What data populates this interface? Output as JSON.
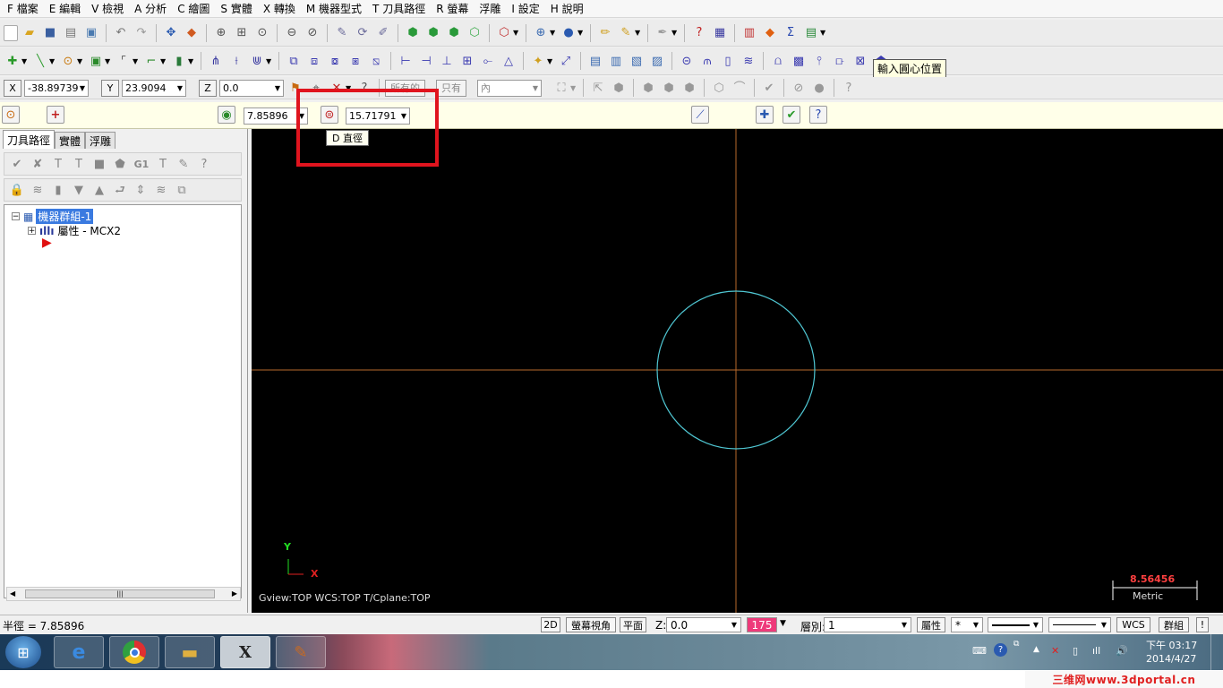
{
  "menu": [
    "F 檔案",
    "E 編輯",
    "V 檢視",
    "A 分析",
    "C 繪圖",
    "S 實體",
    "X 轉換",
    "M 機器型式",
    "T 刀具路徑",
    "R 螢幕",
    "浮雕",
    "I 設定",
    "H 說明"
  ],
  "tooltip_center": "輸入圓心位置",
  "coords": {
    "x_label": "X",
    "x_value": "-38.89739",
    "y_label": "Y",
    "y_value": "23.9094",
    "z_label": "Z",
    "z_value": "0.0"
  },
  "select": {
    "all_label": "所有的",
    "only_label": "只有",
    "mode_value": "內"
  },
  "ribbon": {
    "radius_value": "7.85896",
    "diameter_value": "15.71791",
    "diameter_tip": "D 直徑"
  },
  "panel": {
    "tabs": [
      "刀具路徑",
      "實體",
      "浮雕"
    ],
    "tree_group": "機器群組-1",
    "tree_props": "屬性 - MCX2",
    "gcode_icon_text": "G1"
  },
  "viewport": {
    "axis_y": "Y",
    "axis_x": "X",
    "view_info": "Gview:TOP   WCS:TOP   T/Cplane:TOP",
    "scale_value": "8.56456",
    "scale_unit": "Metric",
    "colors": {
      "background": "#000000",
      "crosshair": "#b86a2c",
      "circle": "#4fc6d2",
      "scale_value": "#ff4040"
    }
  },
  "status": {
    "left_text": "半徑 = 7.85896",
    "btn_2d": "2D",
    "btn_screen_view": "螢幕視角",
    "btn_plane": "平面",
    "z_label": "Z:",
    "z_value": "0.0",
    "color_value": "175",
    "level_label": "層別:",
    "level_value": "1",
    "attr_btn": "屬性",
    "point_style": "*",
    "wcs_btn": "WCS",
    "group_btn": "群組",
    "excl": "!"
  },
  "taskbar": {
    "time": "下午 03:17",
    "date": "2014/4/27",
    "app_label": "X"
  },
  "watermark": "三维网www.3dportal.cn"
}
